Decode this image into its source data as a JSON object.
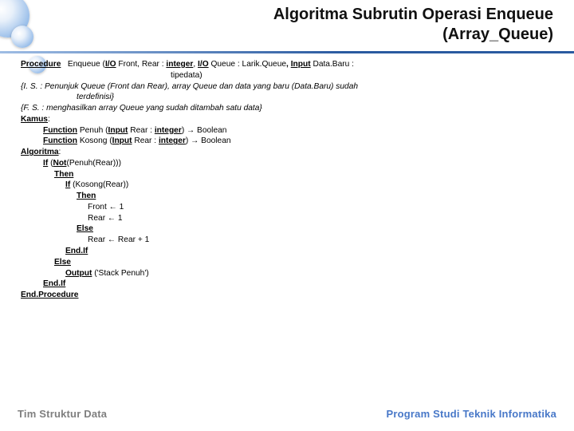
{
  "header": {
    "line1": "Algoritma Subrutin Operasi Enqueue",
    "line2": "(Array_Queue)"
  },
  "proc": {
    "kw_procedure": "Procedure",
    "name": "Enqueue",
    "open": "(",
    "kw_io1": "I/O",
    "sig1": " Front, Rear : ",
    "kw_int1": "integer",
    "comma1": ", ",
    "kw_io2": "I/O",
    "sig2": " Queue : Larik.Queue",
    "comma2": ", ",
    "kw_input": "Input",
    "sig3": " Data.Baru : ",
    "sig_cont": "tipedata)",
    "is": "{I. S. : Penunjuk Queue (Front dan Rear), array Queue dan data yang baru (Data.Baru) sudah",
    "is_cont": "terdefinisi}",
    "fs": "{F. S. : menghasilkan array Queue yang sudah ditambah satu data}",
    "kw_kamus": "Kamus",
    "colon": ":",
    "kw_func": "Function",
    "fn1_name": " Penuh (",
    "fn2_name": " Kosong (",
    "kw_input_p": "Input",
    "fn_sig": "  Rear : ",
    "kw_int_p": "integer",
    "fn_ret": ") → Boolean",
    "kw_algoritma": "Algoritma",
    "kw_if": "If",
    "cond1_a": " (",
    "kw_not": "Not",
    "cond1_b": "(Penuh(Rear)))",
    "kw_then": "Then",
    "cond2": " (Kosong(Rear))",
    "assign_front": "Front  ←  1",
    "assign_rear1": "Rear  ←  1",
    "kw_else": "Else",
    "assign_rear2": "Rear   ←   Rear  +  1",
    "kw_endif": "End.If",
    "kw_output": "Output",
    "out_arg": " ('Stack Penuh')",
    "kw_endproc": "End.Procedure"
  },
  "footer": {
    "left": "Tim Struktur Data",
    "right": "Program Studi Teknik Informatika"
  }
}
